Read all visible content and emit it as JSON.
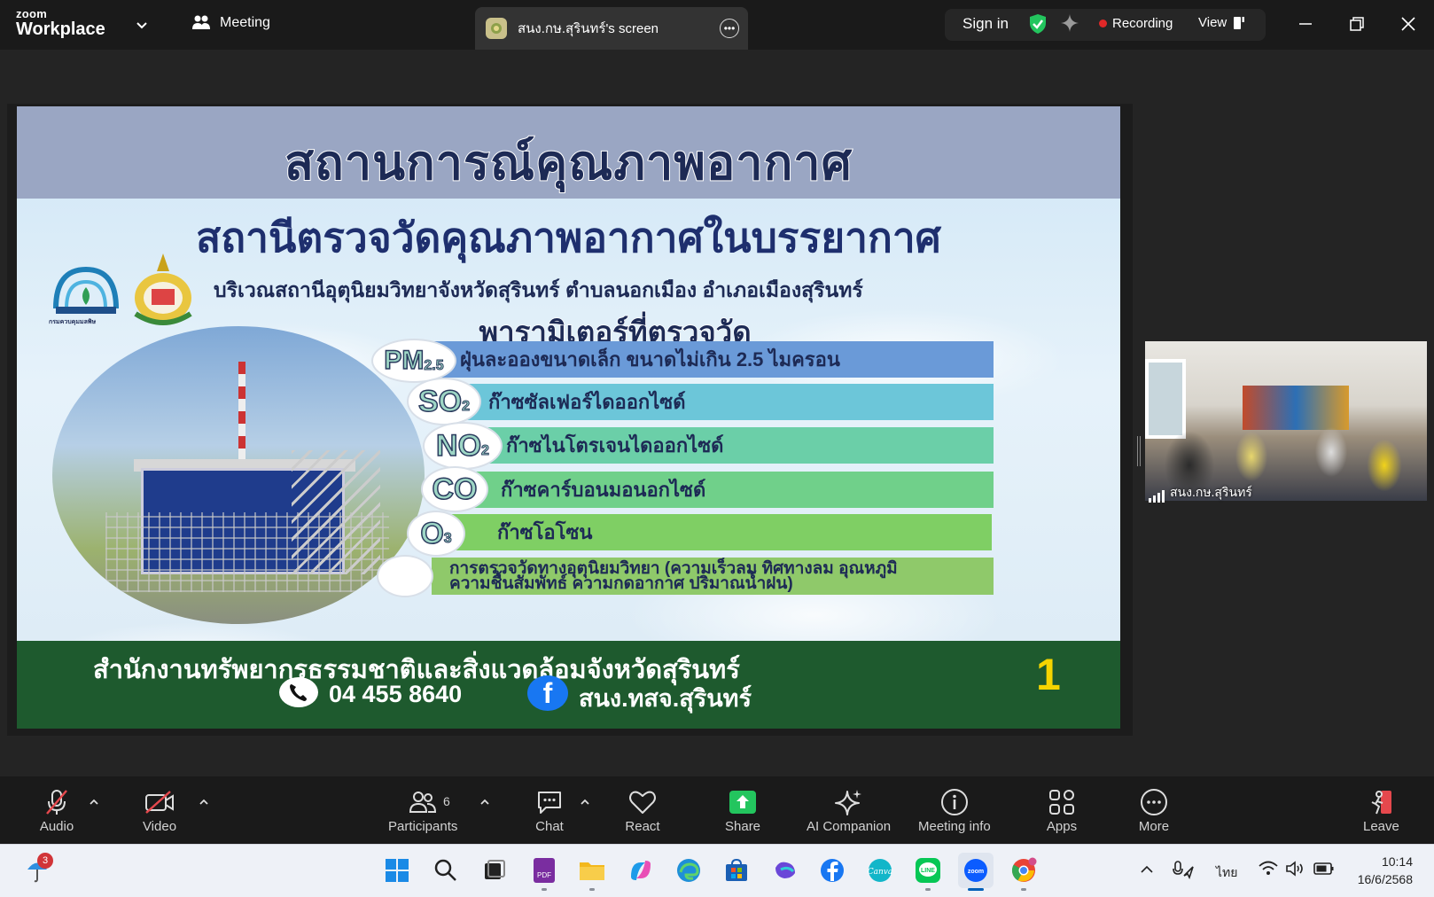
{
  "titlebar": {
    "brand_small": "zoom",
    "brand_big": "Workplace",
    "meeting_label": "Meeting",
    "screen_tab_label": "สนง.กษ.สุรินทร์'s screen",
    "sign_in": "Sign in",
    "recording": "Recording",
    "view": "View"
  },
  "slide": {
    "title": "สถานการณ์คุณภาพอากาศ",
    "station_title": "สถานีตรวจวัดคุณภาพอากาศในบรรยากาศ",
    "location": "บริเวณสถานีอุตุนิยมวิทยาจังหวัดสุรินทร์ ตำบลนอกเมือง อำเภอเมืองสุรินทร์",
    "params_title": "พารามิเตอร์ที่ตรวจวัด",
    "logo_caption": "กรมควบคุมมลพิษ",
    "params": [
      {
        "badge": "PM",
        "sub": "2.5",
        "label": "ฝุ่นละอองขนาดเล็ก ขนาดไม่เกิน 2.5 ไมครอน",
        "color": "#6a9ad8"
      },
      {
        "badge": "SO",
        "sub": "2",
        "label": "ก๊าซซัลเฟอร์ไดออกไซด์",
        "color": "#6cc6d9"
      },
      {
        "badge": "NO",
        "sub": "2",
        "label": "ก๊าซไนโตรเจนไดออกไซด์",
        "color": "#6bcfa8"
      },
      {
        "badge": "CO",
        "sub": "",
        "label": "ก๊าซคาร์บอนมอนอกไซด์",
        "color": "#70d08a"
      },
      {
        "badge": "O",
        "sub": "3",
        "label": "ก๊าซโอโซน",
        "color": "#7fcf64"
      },
      {
        "badge": "",
        "sub": "",
        "label": "การตรวจวัดทางอุตุนิยมวิทยา (ความเร็วลม ทิศทางลม อุณหภูมิ ความชื้นสัมพัทธ์ ความกดอากาศ ปริมาณน้ำฝน)",
        "color": "#8fc96a"
      }
    ],
    "footer_org": "สำนักงานทรัพยากรธรรมชาติและสิ่งแวดล้อมจังหวัดสุรินทร์",
    "phone": "04 455 8640",
    "facebook": "สนง.ทสจ.สุรินทร์",
    "fb_glyph": "f",
    "slide_number": "1"
  },
  "video": {
    "name": "สนง.กษ.สุรินทร์"
  },
  "toolbar": {
    "audio": "Audio",
    "video": "Video",
    "participants": "Participants",
    "participants_count": "6",
    "chat": "Chat",
    "react": "React",
    "share": "Share",
    "ai_companion": "AI Companion",
    "meeting_info": "Meeting info",
    "apps": "Apps",
    "more": "More",
    "leave": "Leave"
  },
  "taskbar": {
    "weather_badge": "3",
    "language": "ไทย",
    "time": "10:14",
    "date": "16/6/2568"
  },
  "colors": {
    "accent": "#0b5cff",
    "recording": "#e02828",
    "share": "#23c55e",
    "footer_green": "#1e5a2e"
  }
}
